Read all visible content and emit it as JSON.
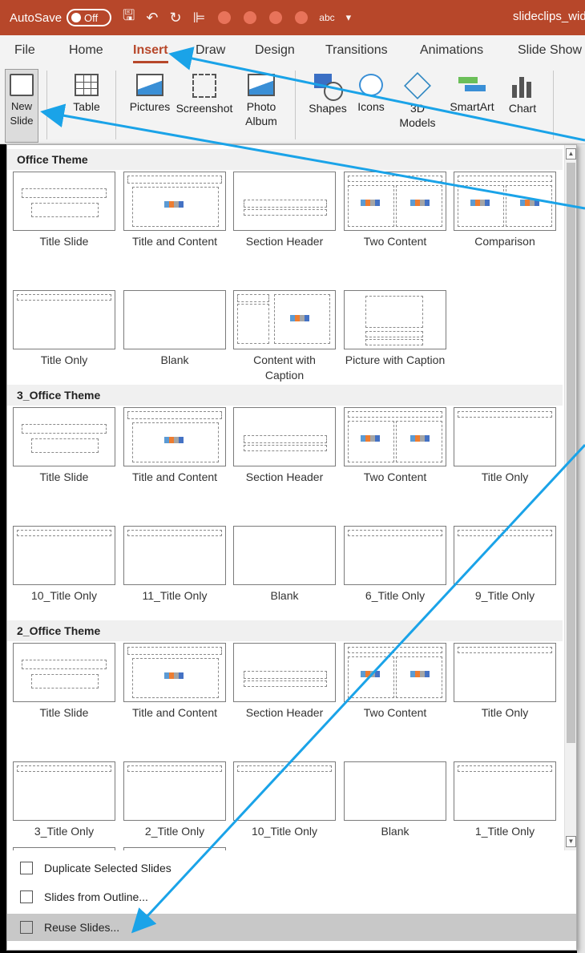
{
  "titlebar": {
    "autosave_label": "AutoSave",
    "autosave_state": "Off",
    "filename": "slideclips_wid"
  },
  "tabs": [
    {
      "label": "File"
    },
    {
      "label": "Home"
    },
    {
      "label": "Insert"
    },
    {
      "label": "Draw"
    },
    {
      "label": "Design"
    },
    {
      "label": "Transitions"
    },
    {
      "label": "Animations"
    },
    {
      "label": "Slide Show"
    }
  ],
  "ribbon": {
    "new_slide": "New Slide",
    "table": "Table",
    "pictures": "Pictures",
    "screenshot": "Screenshot",
    "photo_album": "Photo Album",
    "shapes": "Shapes",
    "icons": "Icons",
    "models_3d": "3D Models",
    "smartart": "SmartArt",
    "chart": "Chart"
  },
  "sections": [
    {
      "title": "Office Theme",
      "layouts": [
        "Title Slide",
        "Title and Content",
        "Section Header",
        "Two Content",
        "Comparison",
        "Title Only",
        "Blank",
        "Content with Caption",
        "Picture with Caption"
      ]
    },
    {
      "title": "3_Office Theme",
      "layouts": [
        "Title Slide",
        "Title and Content",
        "Section Header",
        "Two Content",
        "Title Only",
        "10_Title Only",
        "11_Title Only",
        "Blank",
        "6_Title Only",
        "9_Title Only"
      ]
    },
    {
      "title": "2_Office Theme",
      "layouts": [
        "Title Slide",
        "Title and Content",
        "Section Header",
        "Two Content",
        "Title Only",
        "3_Title Only",
        "2_Title Only",
        "10_Title Only",
        "Blank",
        "1_Title Only"
      ]
    }
  ],
  "menu": {
    "duplicate": "Duplicate Selected Slides",
    "outline": "Slides from Outline...",
    "reuse": "Reuse Slides..."
  },
  "colors": {
    "accent": "#b7472a",
    "arrow": "#1aa3e8",
    "highlight": "#c8c8c8"
  }
}
